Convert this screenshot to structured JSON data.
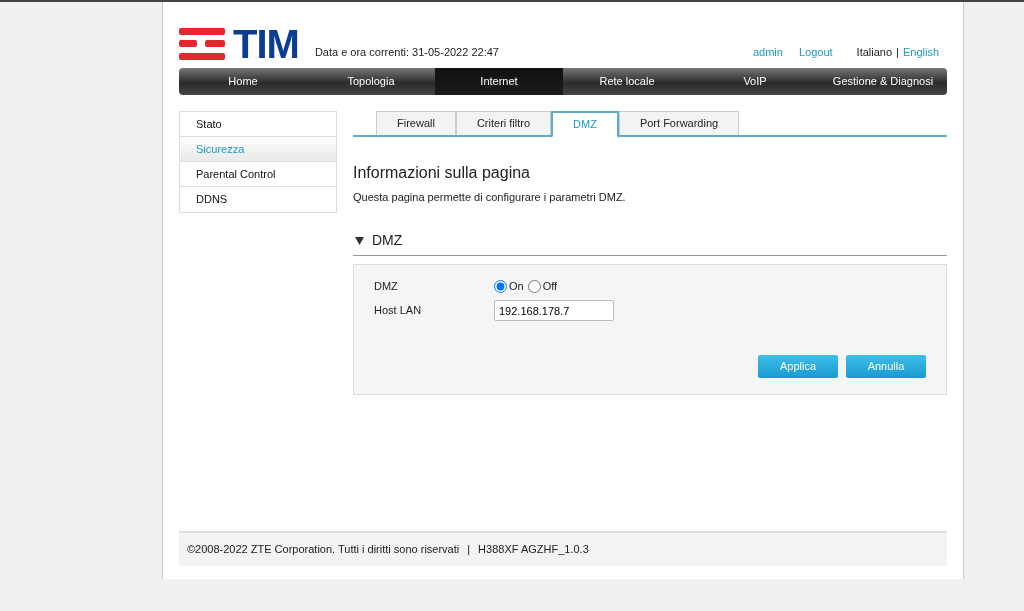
{
  "header": {
    "logo_text": "TIM",
    "datetime": "Data e ora correnti: 31-05-2022 22:47",
    "user_links": [
      "admin",
      "Logout"
    ],
    "languages": [
      {
        "label": "Italiano",
        "selected": true
      },
      {
        "label": "English",
        "selected": false
      }
    ],
    "language_separator": "|"
  },
  "nav": [
    {
      "label": "Home",
      "selected": false
    },
    {
      "label": "Topologia",
      "selected": false
    },
    {
      "label": "Internet",
      "selected": true
    },
    {
      "label": "Rete locale",
      "selected": false
    },
    {
      "label": "VoIP",
      "selected": false
    },
    {
      "label": "Gestione & Diagnosi",
      "selected": false
    }
  ],
  "sidebar": {
    "items": [
      {
        "label": "Stato",
        "selected": false
      },
      {
        "label": "Sicurezza",
        "selected": true
      },
      {
        "label": "Parental Control",
        "selected": false
      },
      {
        "label": "DDNS",
        "selected": false
      }
    ]
  },
  "tabs": [
    {
      "label": "Firewall",
      "selected": false
    },
    {
      "label": "Criteri filtro",
      "selected": false
    },
    {
      "label": "DMZ",
      "selected": true
    },
    {
      "label": "Port Forwarding",
      "selected": false
    }
  ],
  "page_info": {
    "title": "Informazioni sulla pagina",
    "description": "Questa pagina permette di configurare i parametri DMZ."
  },
  "section": {
    "title": "DMZ",
    "expanded": true,
    "fields": [
      {
        "kind": "radio",
        "label": "DMZ",
        "options": [
          {
            "label": "On",
            "selected": true
          },
          {
            "label": "Off",
            "selected": false
          }
        ]
      },
      {
        "kind": "text",
        "label": "Host LAN",
        "value": "192.168.178.7"
      }
    ],
    "buttons": [
      "Applica",
      "Annulla"
    ]
  },
  "footer": {
    "copyright": "©2008-2022 ZTE Corporation. Tutti i diritti sono riservati",
    "separator": "|",
    "version": "H388XF AGZHF_1.0.3"
  }
}
